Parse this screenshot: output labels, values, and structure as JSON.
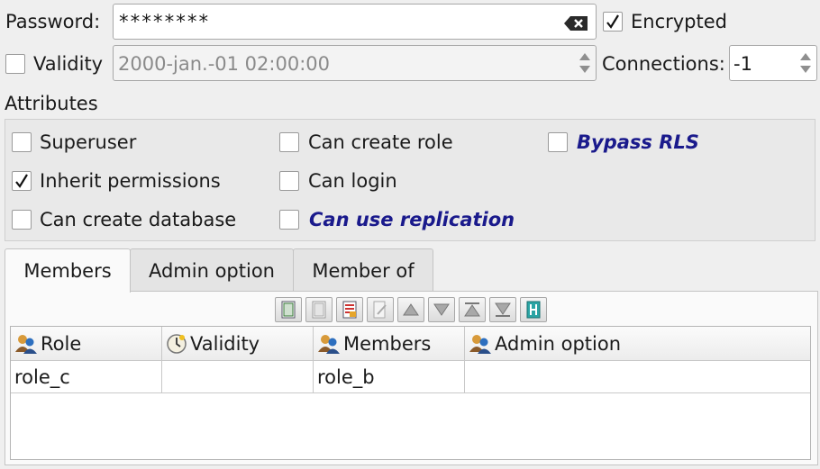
{
  "password": {
    "label": "Password:",
    "value": "********",
    "clear_icon": "backspace-clear-icon"
  },
  "encrypted": {
    "label": "Encrypted",
    "checked": true
  },
  "validity": {
    "label": "Validity",
    "checked": false,
    "value": "2000-jan.-01 02:00:00"
  },
  "connections": {
    "label": "Connections:",
    "value": "-1"
  },
  "attributes": {
    "title": "Attributes",
    "items": [
      {
        "label": "Superuser",
        "checked": false
      },
      {
        "label": "Can create role",
        "checked": false
      },
      {
        "label": "Bypass RLS",
        "checked": false
      },
      {
        "label": "Inherit permissions",
        "checked": true
      },
      {
        "label": "Can login",
        "checked": false
      },
      {
        "label": "Can create database",
        "checked": false
      },
      {
        "label": "Can use replication",
        "checked": false
      }
    ]
  },
  "tabs": [
    {
      "label": "Members",
      "active": true
    },
    {
      "label": "Admin option",
      "active": false
    },
    {
      "label": "Member of",
      "active": false
    }
  ],
  "toolbar": [
    "add-row-icon",
    "delete-row-icon",
    "clear-icon",
    "edit-icon",
    "move-up-icon",
    "move-down-icon",
    "move-top-icon",
    "move-bottom-icon",
    "column-icon"
  ],
  "table": {
    "columns": [
      {
        "label": "Role",
        "icon": "users-icon"
      },
      {
        "label": "Validity",
        "icon": "clock-icon"
      },
      {
        "label": "Members",
        "icon": "users-icon"
      },
      {
        "label": "Admin option",
        "icon": "users-icon"
      }
    ],
    "rows": [
      [
        "role_c",
        "",
        "role_b",
        ""
      ]
    ]
  },
  "colors": {
    "accent_text": "#1a1a8c",
    "background": "#efefef"
  }
}
